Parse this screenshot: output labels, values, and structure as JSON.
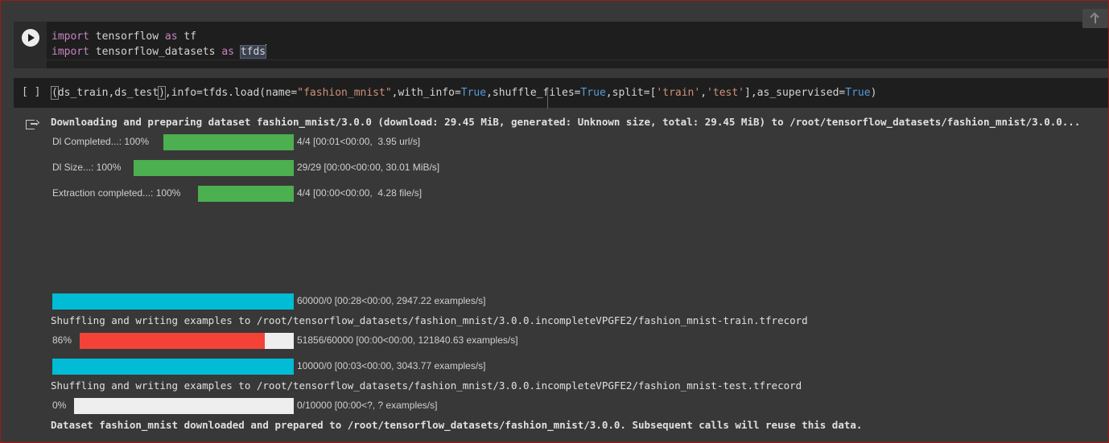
{
  "cell1": {
    "line1": {
      "kw": "import",
      "rest": " tensorflow ",
      "as": "as",
      "alias": " tf"
    },
    "line2": {
      "kw": "import",
      "rest": " tensorflow_datasets ",
      "as": "as",
      "alias": "tfds"
    }
  },
  "cell2": {
    "prompt": "[ ]",
    "p1": "(",
    "p2": "ds_train,ds_test",
    "p3": ")",
    "p4": ",info=tfds.load(name=",
    "s1": "\"fashion_mnist\"",
    "p5": ",with_info=",
    "b1": "True",
    "p6": ",shuffle_files=",
    "b2": "True",
    "p7": ",split=[",
    "s2": "'train'",
    "p8": ",",
    "s3": "'test'",
    "p9": "],as_supervised=",
    "b3": "True",
    "p10": ")"
  },
  "output": {
    "header": "Downloading and preparing dataset fashion_mnist/3.0.0 (download: 29.45 MiB, generated: Unknown size, total: 29.45 MiB) to /root/tensorflow_datasets/fashion_mnist/3.0.0...",
    "bars": [
      {
        "label": "Dl Completed...: 100%",
        "progress": 1.0,
        "info": "4/4 [00:01<00:00,  3.95 url/s]"
      },
      {
        "label": "Dl Size...: 100%",
        "progress": 1.0,
        "info": "29/29 [00:00<00:00, 30.01 MiB/s]"
      },
      {
        "label": "Extraction completed...: 100%",
        "progress": 1.0,
        "info": "4/4 [00:00<00:00,  4.28 file/s]"
      }
    ],
    "shuffle1_bar": {
      "progress": 1.0,
      "info": "60000/0 [00:28<00:00, 2947.22 examples/s]"
    },
    "shuffle1_text": "Shuffling and writing examples to /root/tensorflow_datasets/fashion_mnist/3.0.0.incompleteVPGFE2/fashion_mnist-train.tfrecord",
    "shuffle1_sub": {
      "label": "86%",
      "progress": 0.864,
      "info": "51856/60000 [00:00<00:00, 121840.63 examples/s]"
    },
    "shuffle2_bar": {
      "progress": 1.0,
      "info": "10000/0 [00:03<00:00, 3043.77 examples/s]"
    },
    "shuffle2_text": "Shuffling and writing examples to /root/tensorflow_datasets/fashion_mnist/3.0.0.incompleteVPGFE2/fashion_mnist-test.tfrecord",
    "shuffle2_sub": {
      "label": "0%",
      "progress": 0.0,
      "info": "0/10000 [00:00<?, ? examples/s]"
    },
    "footer": "Dataset fashion_mnist downloaded and prepared to /root/tensorflow_datasets/fashion_mnist/3.0.0. Subsequent calls will reuse this data."
  },
  "colors": {
    "green": "#4caf50",
    "cyan": "#00bcd4",
    "red": "#f44336",
    "track": "#eeeeee"
  }
}
